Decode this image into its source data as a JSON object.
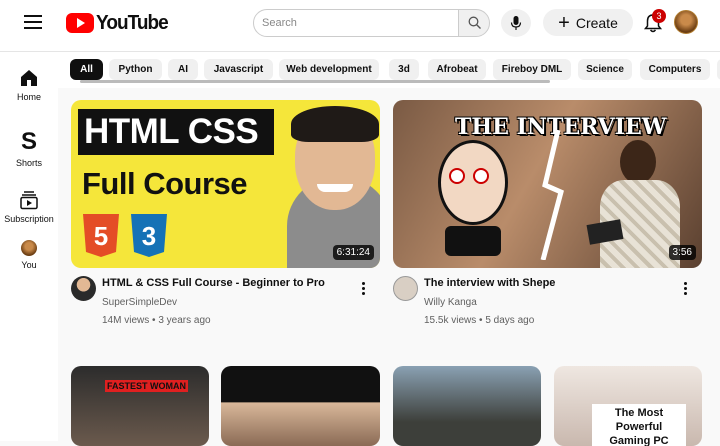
{
  "header": {
    "logo_text": "YouTube",
    "search_placeholder": "Search",
    "create_label": "Create",
    "notification_count": "3"
  },
  "sidebar": {
    "items": [
      {
        "label": "Home",
        "icon": "home-icon"
      },
      {
        "label": "Shorts",
        "icon": "shorts-icon"
      },
      {
        "label": "Subscription",
        "icon": "subscriptions-icon"
      },
      {
        "label": "You",
        "icon": "avatar"
      }
    ]
  },
  "chips": [
    "All",
    "Python",
    "AI",
    "Javascript",
    "Web development",
    "3d",
    "Afrobeat",
    "Fireboy DML",
    "Science",
    "Computers"
  ],
  "videos": [
    {
      "thumb_line1": "HTML CSS",
      "thumb_line2": "Full Course",
      "duration": "6:31:24",
      "title": "HTML & CSS Full Course - Beginner to Pro",
      "channel": "SuperSimpleDev",
      "views": "14M views",
      "age": "3 years ago"
    },
    {
      "thumb_text": "THE INTERVIEW",
      "duration": "3:56",
      "title": "The interview with Shepe",
      "channel": "Willy Kanga",
      "views": "15.5k views",
      "age": "5 days ago"
    }
  ],
  "shorts_thumbs": [
    {
      "overlay": "FASTEST WOMAN"
    },
    {
      "overlay": ""
    },
    {
      "overlay": ""
    },
    {
      "overlay": "The Most Powerful Gaming PC"
    }
  ],
  "meta_separator": "•",
  "colors": {
    "brand_red": "#ff0000",
    "thumb1_bg": "#f5e63a",
    "badge": "#cc0000"
  }
}
